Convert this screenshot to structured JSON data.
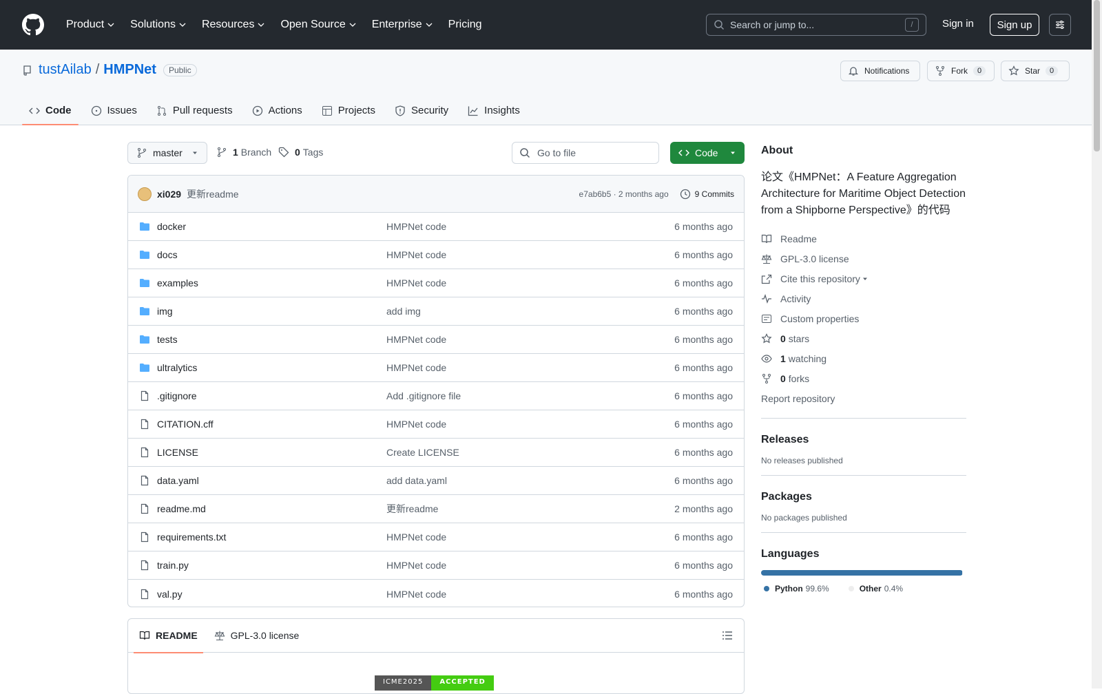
{
  "topnav": {
    "items": [
      "Product",
      "Solutions",
      "Resources",
      "Open Source",
      "Enterprise",
      "Pricing"
    ],
    "search_placeholder": "Search or jump to...",
    "search_shortcut": "/",
    "signin": "Sign in",
    "signup": "Sign up"
  },
  "repo": {
    "owner": "tustAilab",
    "sep": "/",
    "name": "HMPNet",
    "visibility": "Public",
    "notifications": "Notifications",
    "fork_label": "Fork",
    "fork_count": "0",
    "star_label": "Star",
    "star_count": "0",
    "tabs": [
      "Code",
      "Issues",
      "Pull requests",
      "Actions",
      "Projects",
      "Security",
      "Insights"
    ]
  },
  "toolbar": {
    "branch": "master",
    "branches_count": "1",
    "branches_label": "Branch",
    "tags_count": "0",
    "tags_label": "Tags",
    "goto_file": "Go to file",
    "code_button": "Code"
  },
  "commit": {
    "author": "xi029",
    "message": "更新readme",
    "sha_time": "e7ab6b5 · 2 months ago",
    "commits": "9 Commits"
  },
  "files": [
    {
      "name": "docker",
      "type": "dir",
      "msg": "HMPNet code",
      "date": "6 months ago"
    },
    {
      "name": "docs",
      "type": "dir",
      "msg": "HMPNet code",
      "date": "6 months ago"
    },
    {
      "name": "examples",
      "type": "dir",
      "msg": "HMPNet code",
      "date": "6 months ago"
    },
    {
      "name": "img",
      "type": "dir",
      "msg": "add img",
      "date": "6 months ago"
    },
    {
      "name": "tests",
      "type": "dir",
      "msg": "HMPNet code",
      "date": "6 months ago"
    },
    {
      "name": "ultralytics",
      "type": "dir",
      "msg": "HMPNet code",
      "date": "6 months ago"
    },
    {
      "name": ".gitignore",
      "type": "file",
      "msg": "Add .gitignore file",
      "date": "6 months ago"
    },
    {
      "name": "CITATION.cff",
      "type": "file",
      "msg": "HMPNet code",
      "date": "6 months ago"
    },
    {
      "name": "LICENSE",
      "type": "file",
      "msg": "Create LICENSE",
      "date": "6 months ago"
    },
    {
      "name": "data.yaml",
      "type": "file",
      "msg": "add data.yaml",
      "date": "6 months ago"
    },
    {
      "name": "readme.md",
      "type": "file",
      "msg": "更新readme",
      "date": "2 months ago"
    },
    {
      "name": "requirements.txt",
      "type": "file",
      "msg": "HMPNet code",
      "date": "6 months ago"
    },
    {
      "name": "train.py",
      "type": "file",
      "msg": "HMPNet code",
      "date": "6 months ago"
    },
    {
      "name": "val.py",
      "type": "file",
      "msg": "HMPNet code",
      "date": "6 months ago"
    }
  ],
  "readme": {
    "tab_readme": "README",
    "tab_license": "GPL-3.0 license",
    "badge_left": "ICME2025",
    "badge_right": "ACCEPTED"
  },
  "about": {
    "title": "About",
    "description": "论文《HMPNet：A Feature Aggregation Architecture for Maritime Object Detection from a Shipborne Perspective》的代码",
    "readme": "Readme",
    "license": "GPL-3.0 license",
    "cite": "Cite this repository",
    "activity": "Activity",
    "custom_properties": "Custom properties",
    "stars_count": "0",
    "stars_label": "stars",
    "watching_count": "1",
    "watching_label": "watching",
    "forks_count": "0",
    "forks_label": "forks",
    "report": "Report repository"
  },
  "releases": {
    "title": "Releases",
    "empty": "No releases published"
  },
  "packages": {
    "title": "Packages",
    "empty": "No packages published"
  },
  "languages": {
    "title": "Languages",
    "items": [
      {
        "name": "Python",
        "pct": "99.6%",
        "value": 99.6,
        "color": "#3572A5"
      },
      {
        "name": "Other",
        "pct": "0.4%",
        "value": 0.4,
        "color": "#ededed"
      }
    ]
  },
  "colors": {
    "accent": "#0969da",
    "code_button": "#1f883d",
    "topbar": "#24292f"
  }
}
